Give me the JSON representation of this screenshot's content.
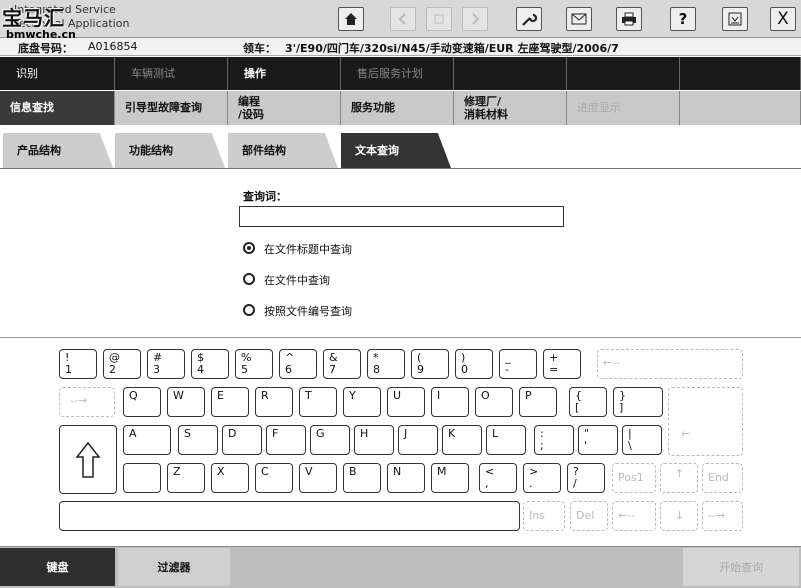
{
  "header": {
    "logo": "宝马汇",
    "app_line1": "Integrated Service",
    "app_line2": "Technical Application",
    "site": "bmwche.cn"
  },
  "toolbar": {
    "home_icon": "home-icon",
    "back_icon": "back-icon",
    "stop_icon": "stop-icon",
    "forward_icon": "forward-icon",
    "wrench_icon": "wrench-icon",
    "mail_icon": "mail-icon",
    "print_icon": "print-icon",
    "help_label": "?",
    "minimize_icon": "minimize-icon",
    "close_label": "X"
  },
  "info": {
    "chassis_label": "底盘号码：",
    "chassis_value": "A016854",
    "vehicle_label": "领车：",
    "vehicle_value": "3'/E90/四门车/320si/N45/手动变速箱/EUR 左座驾驶型/2006/7"
  },
  "menu1": [
    "识别",
    "车辆测试",
    "操作",
    "售后服务计划",
    "",
    "",
    ""
  ],
  "menu2": [
    "信息查找",
    "引导型故障查询",
    "编程\n/设码",
    "服务功能",
    "修理厂/\n消耗材料",
    "进度显示"
  ],
  "tabs": [
    "产品结构",
    "功能结构",
    "部件结构",
    "文本查询"
  ],
  "search": {
    "label": "查询词：",
    "value": "",
    "options": [
      "在文件标题中查询",
      "在文件中查询",
      "按照文件编号查询"
    ],
    "selected_index": 0
  },
  "keyboard": {
    "row1": [
      [
        "!",
        "1"
      ],
      [
        "@",
        "2"
      ],
      [
        "#",
        "3"
      ],
      [
        "$",
        "4"
      ],
      [
        "%",
        "5"
      ],
      [
        "^",
        "6"
      ],
      [
        "&",
        "7"
      ],
      [
        "*",
        "8"
      ],
      [
        "(",
        "9"
      ],
      [
        ")",
        "0"
      ],
      [
        "_",
        "-"
      ],
      [
        "+",
        "="
      ]
    ],
    "row1_backspace": "←--",
    "row2_tab": "--→",
    "row2": [
      [
        "Q",
        ""
      ],
      [
        "W",
        ""
      ],
      [
        "E",
        ""
      ],
      [
        "R",
        ""
      ],
      [
        "T",
        ""
      ],
      [
        "Y",
        ""
      ],
      [
        "U",
        ""
      ],
      [
        "I",
        ""
      ],
      [
        "O",
        ""
      ],
      [
        "P",
        ""
      ],
      [
        "{",
        "["
      ],
      [
        "}",
        "]"
      ]
    ],
    "row3": [
      [
        "A",
        ""
      ],
      [
        "S",
        ""
      ],
      [
        "D",
        ""
      ],
      [
        "F",
        ""
      ],
      [
        "G",
        ""
      ],
      [
        "H",
        ""
      ],
      [
        "J",
        ""
      ],
      [
        "K",
        ""
      ],
      [
        "L",
        ""
      ],
      [
        ":",
        ";"
      ],
      [
        "\"",
        "'"
      ],
      [
        "|",
        "\\"
      ]
    ],
    "row3_enter": "←",
    "row4": [
      [
        "Z",
        ""
      ],
      [
        "X",
        ""
      ],
      [
        "C",
        ""
      ],
      [
        "V",
        ""
      ],
      [
        "B",
        ""
      ],
      [
        "N",
        ""
      ],
      [
        "M",
        ""
      ],
      [
        "<",
        ","
      ],
      [
        ">",
        "."
      ],
      [
        "?",
        "/"
      ]
    ],
    "shift_icon": "shift-arrow-icon",
    "pos1": "Pos1",
    "end": "End",
    "ins": "Ins",
    "del": "Del",
    "arrow_up": "↑",
    "arrow_down": "↓",
    "arrow_left": "←--",
    "arrow_right": "--→"
  },
  "bottom": {
    "keyboard_label": "键盘",
    "filter_label": "过滤器",
    "start_label": "开始查询"
  }
}
